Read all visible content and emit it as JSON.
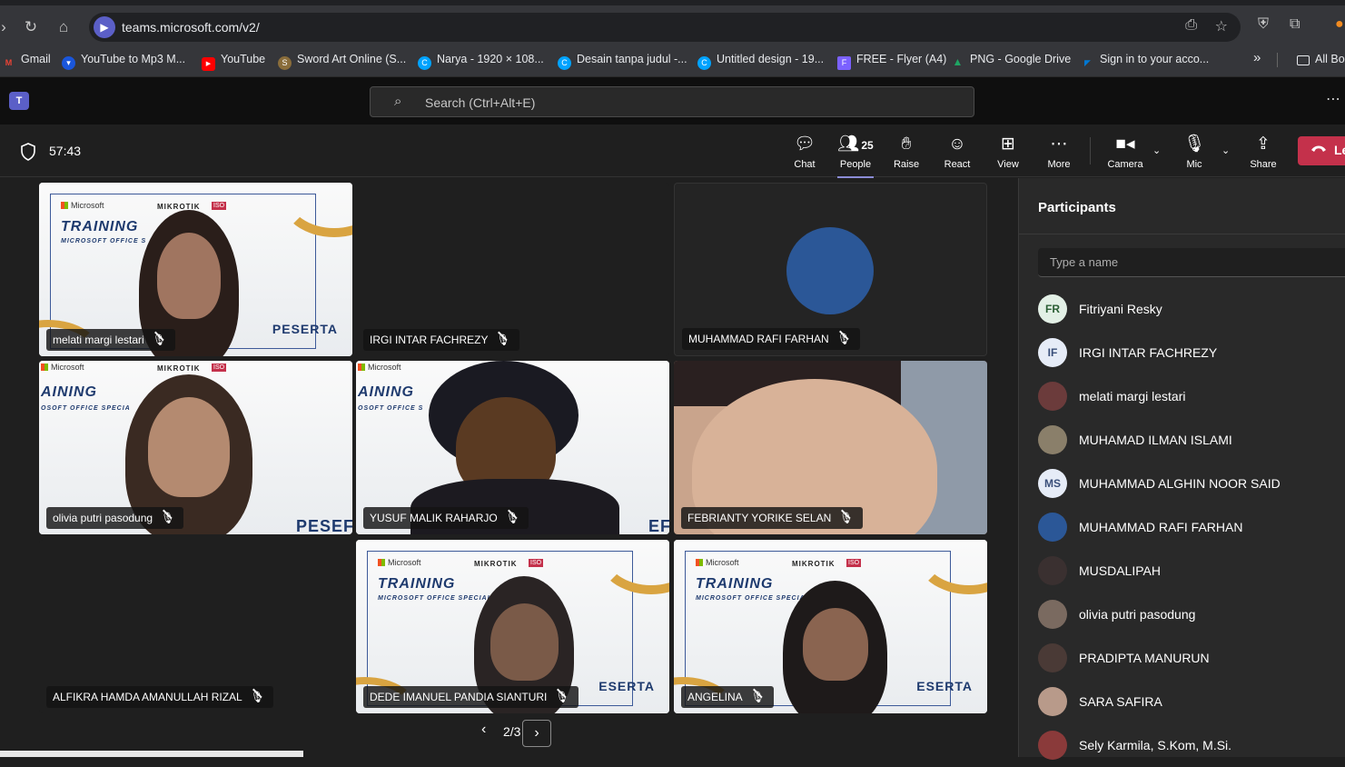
{
  "browser": {
    "url": "teams.microsoft.com/v2/",
    "bookmarks": [
      {
        "label": "Gmail",
        "color": "#ea4335",
        "glyph": "M"
      },
      {
        "label": "YouTube to Mp3 M...",
        "color": "#1a56db",
        "glyph": "▾"
      },
      {
        "label": "YouTube",
        "color": "#ff0000",
        "glyph": "▶"
      },
      {
        "label": "Sword Art Online (S...",
        "color": "#8a6d3b",
        "glyph": "S"
      },
      {
        "label": "Narya - 1920 × 108...",
        "color": "#00a3ff",
        "glyph": "C"
      },
      {
        "label": "Desain tanpa judul -...",
        "color": "#00a3ff",
        "glyph": "C"
      },
      {
        "label": "Untitled design - 19...",
        "color": "#00a3ff",
        "glyph": "C"
      },
      {
        "label": "FREE - Flyer (A4)",
        "color": "#7b61ff",
        "glyph": "F"
      },
      {
        "label": "PNG - Google Drive",
        "color": "#1fa463",
        "glyph": "▲"
      },
      {
        "label": "Sign in to your acco...",
        "color": "#0078d4",
        "glyph": "◤"
      }
    ],
    "all_bookmarks": "All Bo"
  },
  "teams": {
    "logo": "T",
    "search_placeholder": "Search (Ctrl+Alt+E)"
  },
  "meeting": {
    "timer": "57:43",
    "people_count": "25",
    "tools": {
      "chat": "Chat",
      "people": "People",
      "raise": "Raise",
      "react": "React",
      "view": "View",
      "more": "More",
      "camera": "Camera",
      "mic": "Mic",
      "share": "Share"
    },
    "leave": "Le"
  },
  "tiles": [
    {
      "name": "melati margi lestari"
    },
    {
      "name": "IRGI INTAR FACHREZY"
    },
    {
      "name": "MUHAMMAD RAFI FARHAN"
    },
    {
      "name": "olivia putri pasodung"
    },
    {
      "name": "YUSUF MALIK RAHARJO"
    },
    {
      "name": "FEBRIANTY YORIKE SELAN"
    },
    {
      "name": "ALFIKRA HAMDA AMANULLAH RIZAL"
    },
    {
      "name": "DEDE IMANUEL PANDIA SIANTURI"
    },
    {
      "name": "ANGELINA"
    }
  ],
  "banner": {
    "microsoft": "Microsoft",
    "mikrotik": "MIKROTIK",
    "iso": "ISO",
    "training": "TRAINING",
    "training_cut": "AINING",
    "office": "MICROSOFT OFFICE S",
    "office_full": "MICROSOFT OFFICE SPECIALIST",
    "office_cut": "OSOFT OFFICE SPECIA",
    "office_cut2": "OSOFT OFFICE S",
    "peserta": "PESERTA",
    "peserta_cut": "PESEF",
    "peserta_cut2": "ESERTA",
    "peserta_cut3": "EF"
  },
  "pager": {
    "label": "2/3"
  },
  "participants": {
    "title": "Participants",
    "search_placeholder": "Type a name",
    "list": [
      {
        "initials": "FR",
        "name": "Fitriyani Resky",
        "avatar_bg": "#e3f0e6",
        "avatar_fg": "#2b5e34"
      },
      {
        "initials": "IF",
        "name": "IRGI INTAR FACHREZY",
        "avatar_bg": "#e6ecf7",
        "avatar_fg": "#3a4f7a"
      },
      {
        "initials": "",
        "name": "melati margi lestari",
        "avatar_bg": "#6b3b3b",
        "avatar_fg": "#fff"
      },
      {
        "initials": "",
        "name": "MUHAMAD ILMAN ISLAMI",
        "avatar_bg": "#8a7f6a",
        "avatar_fg": "#fff"
      },
      {
        "initials": "MS",
        "name": "MUHAMMAD ALGHIN NOOR SAID",
        "avatar_bg": "#e6ecf7",
        "avatar_fg": "#3a4f7a"
      },
      {
        "initials": "",
        "name": "MUHAMMAD RAFI FARHAN",
        "avatar_bg": "#2b5797",
        "avatar_fg": "#fff"
      },
      {
        "initials": "",
        "name": "MUSDALIPAH",
        "avatar_bg": "#3a3030",
        "avatar_fg": "#fff"
      },
      {
        "initials": "",
        "name": "olivia putri pasodung",
        "avatar_bg": "#7a6a60",
        "avatar_fg": "#fff"
      },
      {
        "initials": "",
        "name": "PRADIPTA MANURUN",
        "avatar_bg": "#4a3a36",
        "avatar_fg": "#fff"
      },
      {
        "initials": "",
        "name": "SARA SAFIRA",
        "avatar_bg": "#b89a8a",
        "avatar_fg": "#fff"
      },
      {
        "initials": "",
        "name": "Sely Karmila, S.Kom, M.Si.",
        "avatar_bg": "#8a3a3a",
        "avatar_fg": "#fff"
      }
    ]
  }
}
